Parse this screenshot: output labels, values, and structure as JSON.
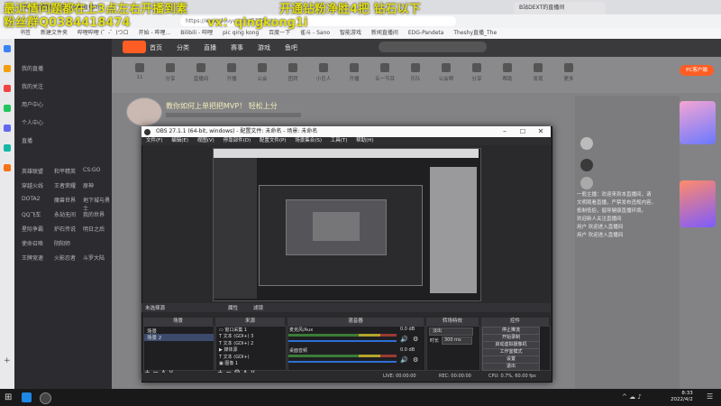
{
  "overlay": {
    "line1": "最近情问题都在上3点左右开播到素",
    "line2": "开通钻粉净胜4把 钻石以下",
    "line3": "粉丝群Q0384418474",
    "line4": "vx：qingkong1i"
  },
  "browser": {
    "tab_label": "我心有盟的的直播 - 斗鱼直播间",
    "tab2_label": "B站DEXT的直播间",
    "url": "https://www.douyu.com/5372.../...",
    "bookmarks": [
      "书签",
      "新建文件夹",
      "哔哩哔哩 (゜-゜)つロ",
      "开始 - 哔哩...",
      "Bilibili - 哔哩",
      "pic qing kong",
      "百度一下",
      "雀斗 - Sano",
      "智能游戏",
      "新闻直播间",
      "EDG-Pandeta",
      "Theshy直播_The"
    ]
  },
  "site": {
    "nav": [
      "首页",
      "分类",
      "直播",
      "赛事",
      "游戏",
      "鱼吧"
    ],
    "categories": [
      "11",
      "分享",
      "直播间",
      "开播",
      "公会",
      "团拜",
      "小巨人",
      "开播",
      "五一节目",
      "乐队",
      "公会帮",
      "分享",
      "帮助",
      "发现",
      "更多"
    ],
    "title": "教你如何上单把把MVP！ 轻松上分",
    "pc_tag": "PC客户端"
  },
  "sidenav": {
    "items": [
      "我的直播",
      "我的关注",
      "用户中心",
      "个人中心",
      "直播"
    ],
    "grid": [
      "英雄联盟",
      "和平精英",
      "CS:GO",
      "穿越火线",
      "王者荣耀",
      "原神",
      "DOTA2",
      "魔兽世界",
      "地下城与勇士",
      "QQ飞车",
      "永劫无间",
      "我的世界",
      "星际争霸",
      "炉石传说",
      "明日之后",
      "使命召唤",
      "阴阳师",
      "王牌竞速",
      "火影忍者",
      "斗罗大陆"
    ]
  },
  "chat": [
    "一般主播：欢迎来到本直播间，请",
    "文明观看直播，严禁发布违规内容，",
    "抵制低俗，倡导健康直播环境。",
    "欢迎新人关注直播间",
    "用户 欢迎进入直播间",
    "用户 欢迎进入直播间"
  ],
  "obs": {
    "title": "OBS 27.1.1 (64-bit, windows) - 配置文件: 未命名 - 场景: 未命名",
    "menu": [
      "文件(F)",
      "编辑(E)",
      "视图(V)",
      "停靠部件(D)",
      "配置文件(P)",
      "场景集合(S)",
      "工具(T)",
      "帮助(H)"
    ],
    "no_source": "未选择源",
    "properties": "属性",
    "filters": "滤镜",
    "docks": {
      "scenes": "场景",
      "sources": "来源",
      "mixer": "混音器",
      "transitions": "转场特效",
      "controls": "控件"
    },
    "scenes": [
      "场景",
      "场景 2"
    ],
    "sources": [
      "窗口采集 1",
      "文本 (GDI+) 3",
      "文本 (GDI+) 2",
      "媒体源",
      "文本 (GDI+)",
      "图像 1"
    ],
    "mixer": [
      {
        "name": "麦克风/Aux",
        "db": "0.0 dB"
      },
      {
        "name": "桌面音频",
        "db": "0.0 dB"
      }
    ],
    "transition": "淡出",
    "duration_label": "时长",
    "duration_value": "300 ms",
    "controls": [
      "停止推流",
      "开始录制",
      "启动虚拟摄像机",
      "工作室模式",
      "设置",
      "退出"
    ],
    "status": {
      "live": "LIVE: 00:00:00",
      "rec": "REC: 00:00:00",
      "cpu": "CPU: 0.7%, 60.00 fps"
    }
  },
  "taskbar": {
    "time": "8:33",
    "date": "2022/4/2"
  },
  "colors": {
    "overlay_yellow": "#e1dd19",
    "obs_bg": "#2a2a2d",
    "douyu_orange": "#ff5d23",
    "blue_volume": "#2e6fd6"
  }
}
